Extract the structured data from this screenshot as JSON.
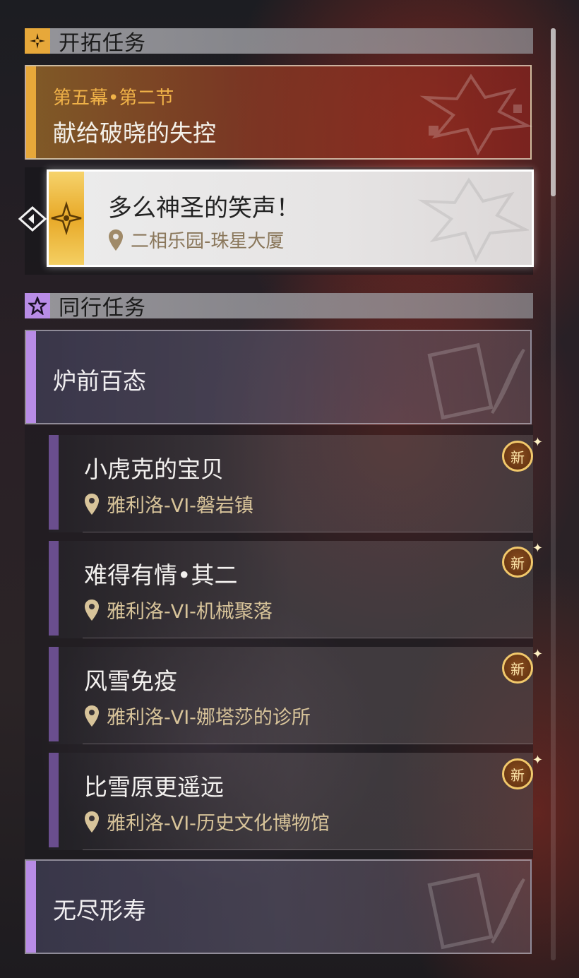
{
  "trailblaze_section": {
    "header": "开拓任务",
    "active_quest": {
      "chapter": "第五幕•第二节",
      "title": "献给破晓的失控"
    },
    "current_step": {
      "title": "多么神圣的笑声！",
      "location": "二相乐园-珠星大厦"
    }
  },
  "companion_section": {
    "header": "同行任务",
    "groups": [
      {
        "title": "炉前百态",
        "quests": [
          {
            "title": "小虎克的宝贝",
            "location": "雅利洛-VI-磐岩镇",
            "badge": "新"
          },
          {
            "title": "难得有情•其二",
            "location": "雅利洛-VI-机械聚落",
            "badge": "新"
          },
          {
            "title": "风雪免疫",
            "location": "雅利洛-VI-娜塔莎的诊所",
            "badge": "新"
          },
          {
            "title": "比雪原更遥远",
            "location": "雅利洛-VI-历史文化博物馆",
            "badge": "新"
          }
        ]
      },
      {
        "title": "无尽形寿",
        "quests": []
      }
    ]
  },
  "colors": {
    "trailblaze_accent": "#e7a83a",
    "companion_accent": "#b88ce6",
    "quest_bar": "#6a4e8e",
    "location_text": "#d8c49a"
  }
}
